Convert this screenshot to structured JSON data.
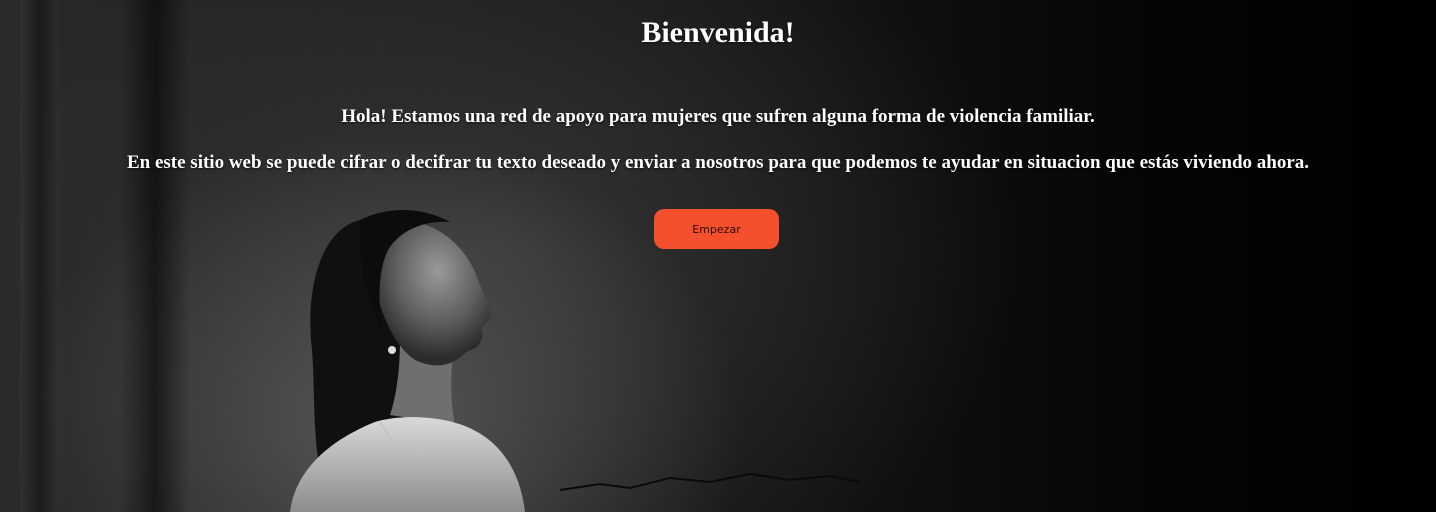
{
  "hero": {
    "title": "Bienvenida!",
    "intro": "Hola! Estamos una red de apoyo para mujeres que sufren alguna forma de violencia familiar.",
    "description": "En este sitio web se puede cifrar o decifrar tu texto deseado y enviar a nosotros para que podemos te ayudar en situacion que estás viviendo ahora.",
    "start_button_label": "Empezar"
  },
  "colors": {
    "accent": "#f4502e",
    "text": "#ffffff",
    "background": "#000000"
  }
}
